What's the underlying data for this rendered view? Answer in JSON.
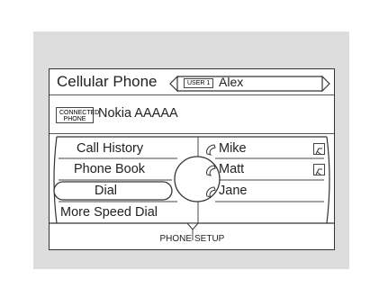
{
  "header": {
    "title": "Cellular Phone",
    "user_tag": "USER 1",
    "user_name": "Alex"
  },
  "connection": {
    "tag_line1": "CONNECTED",
    "tag_line2": "PHONE",
    "phone_name": "Nokia AAAAA"
  },
  "menu": {
    "items": [
      {
        "label": "Call History"
      },
      {
        "label": "Phone Book"
      },
      {
        "label": "Dial",
        "selected": true
      },
      {
        "label": "More Speed Dial"
      }
    ]
  },
  "speed_dial": {
    "contacts": [
      {
        "name": "Mike",
        "has_badge": true
      },
      {
        "name": "Matt",
        "has_badge": true
      },
      {
        "name": "Jane",
        "has_badge": false
      }
    ]
  },
  "footer": {
    "left_label": "PHONE",
    "right_label": "SETUP"
  },
  "icons": [
    "left-arrow-icon",
    "right-arrow-icon",
    "handset-icon",
    "phone-badge-icon",
    "down-arrow-icon"
  ]
}
